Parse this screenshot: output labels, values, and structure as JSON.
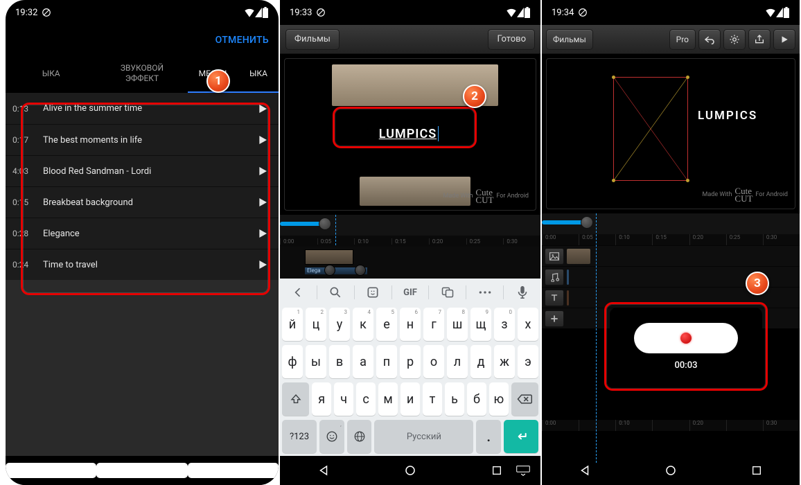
{
  "panel1": {
    "status_time": "19:32",
    "cancel": "ОТМЕНИТЬ",
    "tabs": {
      "music": "ЫКА",
      "sfx": "ЗВУКОВОЙ\nЭФФЕКТ",
      "local": "МЕСТН           ЫКА"
    },
    "tracks": [
      {
        "dur": "0:13",
        "title": "Alive in the summer time"
      },
      {
        "dur": "0:17",
        "title": "The best moments in life"
      },
      {
        "dur": "4:03",
        "title": "Blood Red Sandman - Lordi"
      },
      {
        "dur": "0:15",
        "title": "Breakbeat background"
      },
      {
        "dur": "0:28",
        "title": "Elegance"
      },
      {
        "dur": "0:24",
        "title": "Time to travel"
      }
    ],
    "badge": "1"
  },
  "panel2": {
    "status_time": "19:33",
    "toolbar": {
      "films": "Фильмы",
      "done": "Готово"
    },
    "text_overlay": "LUMPICS",
    "watermark": {
      "made": "Made With",
      "brand": "Cute\nCUT",
      "platform": "For Android"
    },
    "ruler": [
      "0:00",
      "0:05",
      "0:10",
      "0:15",
      "0:20",
      "0:25",
      "0:30"
    ],
    "audio_clip_label": "Elega",
    "keyboard": {
      "gif": "GIF",
      "row1": [
        {
          "k": "й",
          "h": "1"
        },
        {
          "k": "ц",
          "h": "2"
        },
        {
          "k": "у",
          "h": "3"
        },
        {
          "k": "к",
          "h": "4"
        },
        {
          "k": "е",
          "h": "5"
        },
        {
          "k": "н",
          "h": "6"
        },
        {
          "k": "г",
          "h": "7"
        },
        {
          "k": "ш",
          "h": "8"
        },
        {
          "k": "щ",
          "h": "9"
        },
        {
          "k": "з",
          "h": "0"
        },
        {
          "k": "х",
          "h": ""
        }
      ],
      "row2": [
        "ф",
        "ы",
        "в",
        "а",
        "п",
        "р",
        "о",
        "л",
        "д",
        "ж",
        "э"
      ],
      "row3": [
        "я",
        "ч",
        "с",
        "м",
        "и",
        "т",
        "ь",
        "б",
        "ю"
      ],
      "modeKey": "?123",
      "spaceLabel": "Русский"
    },
    "badge": "2"
  },
  "panel3": {
    "status_time": "19:34",
    "toolbar": {
      "films": "Фильмы",
      "pro": "Pro"
    },
    "text_overlay": "LUMPICS",
    "watermark": {
      "made": "Made With",
      "brand": "Cute\nCUT",
      "platform": "For Android"
    },
    "ruler": [
      "0:00",
      "0:05",
      "0:10",
      "0:15",
      "0:20",
      "0:25",
      "0:30"
    ],
    "ruler2": [
      "0:00",
      "",
      "0:10",
      "",
      "0:20",
      "",
      "0:30"
    ],
    "rec_time": "00:03",
    "badge": "3"
  }
}
